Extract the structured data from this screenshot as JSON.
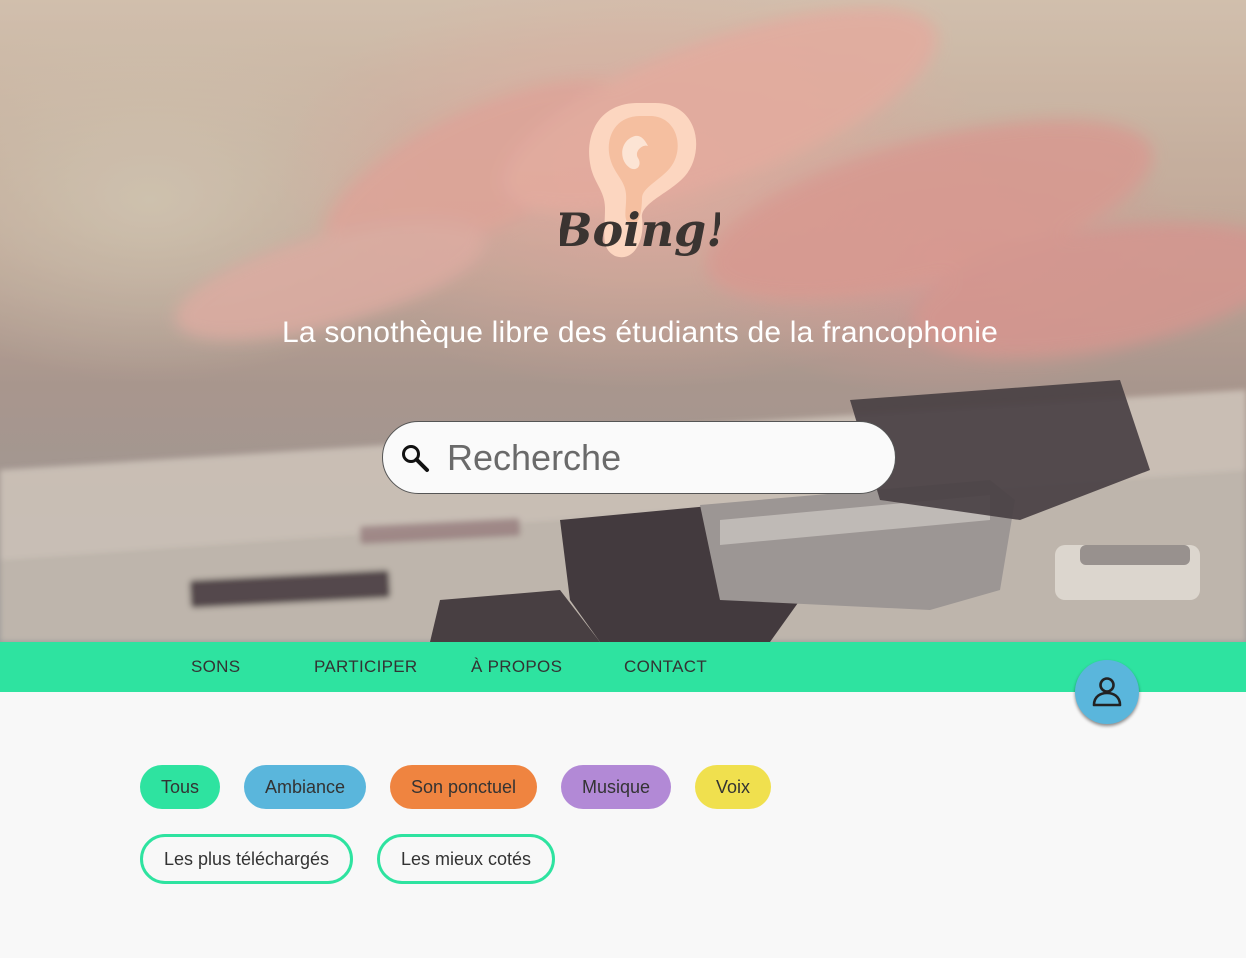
{
  "logo": {
    "text": "Boing!"
  },
  "hero": {
    "tagline": "La sonothèque libre des étudiants de la francophonie"
  },
  "search": {
    "placeholder": "Recherche",
    "icon": "search-icon"
  },
  "nav": {
    "items": [
      {
        "label": "SONS"
      },
      {
        "label": "PARTICIPER"
      },
      {
        "label": "À PROPOS"
      },
      {
        "label": "CONTACT"
      }
    ],
    "color": "#2ee3a0",
    "account_icon": "user-icon"
  },
  "categories": [
    {
      "label": "Tous",
      "color": "#2ee3a0"
    },
    {
      "label": "Ambiance",
      "color": "#5ab6dc"
    },
    {
      "label": "Son ponctuel",
      "color": "#ef8440"
    },
    {
      "label": "Musique",
      "color": "#b289d6"
    },
    {
      "label": "Voix",
      "color": "#f0e04e"
    }
  ],
  "sort_filters": [
    {
      "label": "Les plus téléchargés"
    },
    {
      "label": "Les mieux cotés"
    }
  ]
}
